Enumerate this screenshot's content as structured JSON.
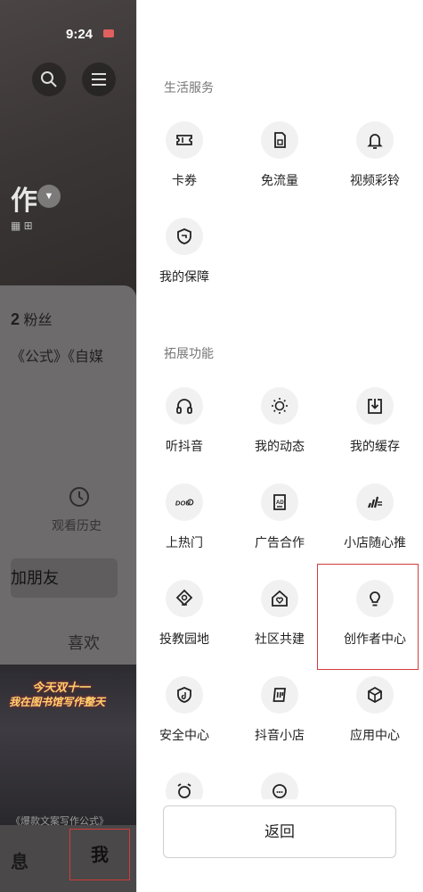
{
  "status": {
    "time": "9:24"
  },
  "profile": {
    "nickname": "作",
    "fans_count": "2",
    "fans_label": "粉丝",
    "bio": "《公式》《自媒",
    "history_label": "观看历史",
    "add_friend_label": "加朋友",
    "likes_tab": "喜欢",
    "video_text_line1": "今天双十一",
    "video_text_line2": "我在图书馆写作整天",
    "video_caption": "《爆款文案写作公式》",
    "bottom_tabs": [
      "息",
      "我"
    ]
  },
  "drawer": {
    "life_services": {
      "title": "生活服务",
      "items": [
        {
          "label": "卡券",
          "icon": "ticket-icon"
        },
        {
          "label": "免流量",
          "icon": "sim-card-icon"
        },
        {
          "label": "视频彩铃",
          "icon": "bell-icon"
        },
        {
          "label": "我的保障",
          "icon": "shield-icon"
        }
      ]
    },
    "extended": {
      "title": "拓展功能",
      "items": [
        {
          "label": "听抖音",
          "icon": "headphones-icon"
        },
        {
          "label": "我的动态",
          "icon": "activity-icon"
        },
        {
          "label": "我的缓存",
          "icon": "download-icon"
        },
        {
          "label": "上热门",
          "icon": "dou-plus-icon"
        },
        {
          "label": "广告合作",
          "icon": "ad-icon"
        },
        {
          "label": "小店随心推",
          "icon": "promote-icon"
        },
        {
          "label": "投教园地",
          "icon": "education-icon"
        },
        {
          "label": "社区共建",
          "icon": "community-icon"
        },
        {
          "label": "创作者中心",
          "icon": "lightbulb-icon"
        },
        {
          "label": "安全中心",
          "icon": "security-icon"
        },
        {
          "label": "抖音小店",
          "icon": "shop-icon"
        },
        {
          "label": "应用中心",
          "icon": "app-center-icon"
        }
      ]
    },
    "back_label": "返回"
  }
}
